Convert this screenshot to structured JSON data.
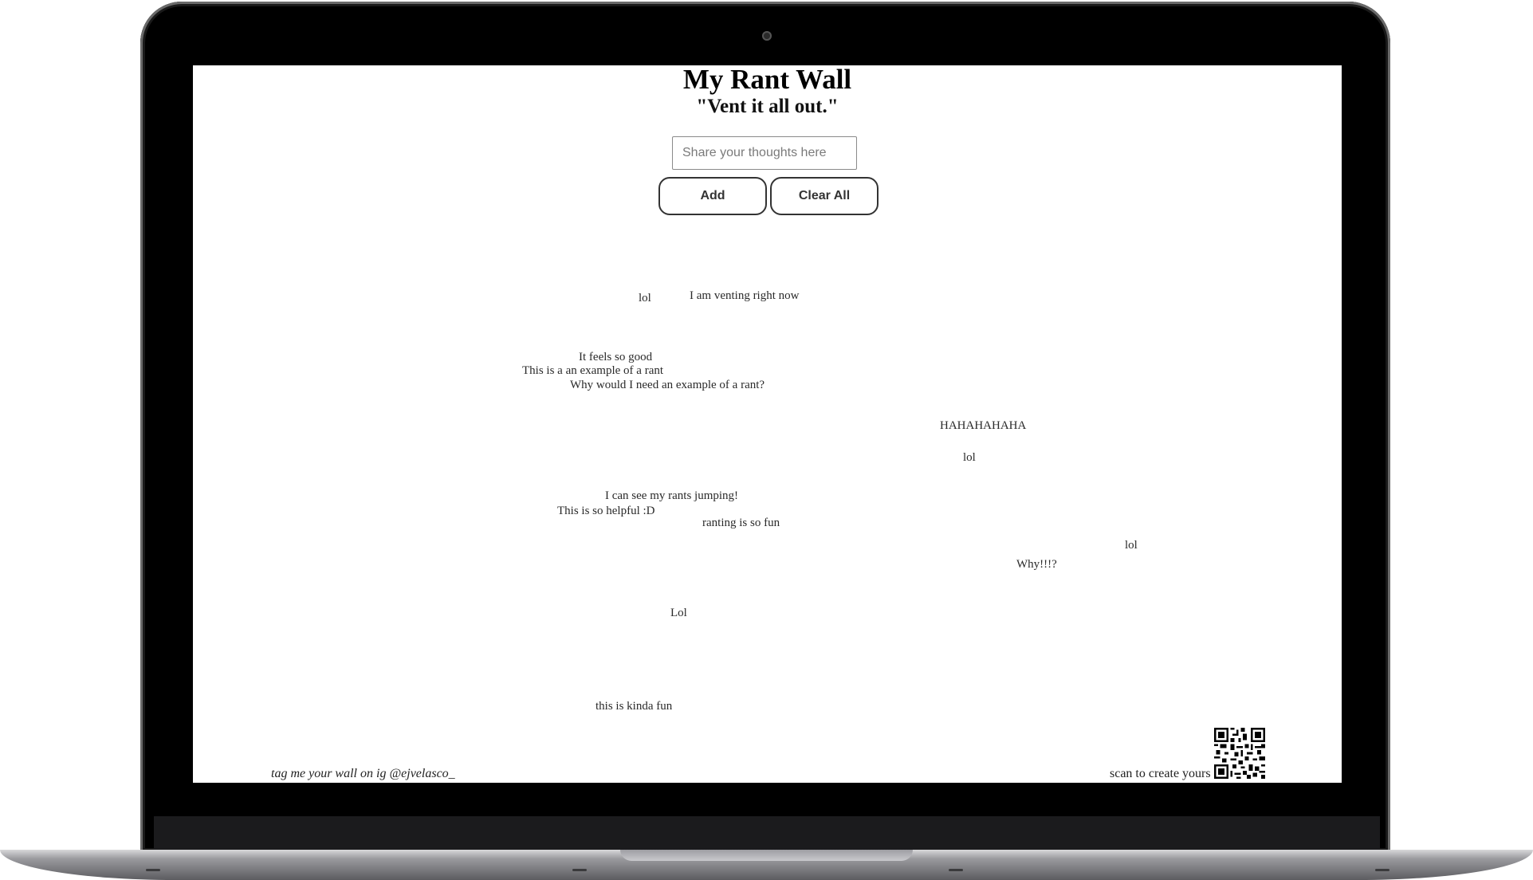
{
  "app": {
    "title": "My Rant Wall",
    "subtitle": "\"Vent it all out.\""
  },
  "composer": {
    "placeholder": "Share your thoughts here",
    "value": "",
    "add_label": "Add",
    "clear_label": "Clear All"
  },
  "rants": [
    "lol",
    "I am venting right now",
    "It feels so good",
    "This is a an example of a rant",
    "Why would I need an example of a rant?",
    "HAHAHAHAHA",
    "lol",
    "I can see my rants jumping!",
    "This is so helpful :D",
    "ranting is so fun",
    "lol",
    "Why!!!?",
    "Lol",
    "this is kinda fun"
  ],
  "footer": {
    "tag_text": "tag me your wall on ig @ejvelasco_",
    "scan_text": "scan to create yours",
    "qr_icon": "qr-code-icon"
  },
  "colors": {
    "frame": "#000000",
    "screen": "#ffffff",
    "button_border": "#333333"
  }
}
